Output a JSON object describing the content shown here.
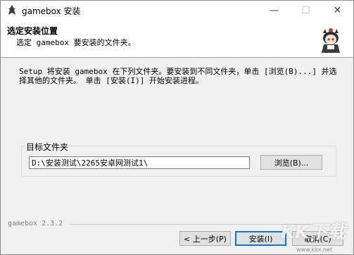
{
  "window": {
    "title": "gamebox 安装",
    "controls": {
      "minimize": "—",
      "maximize": "☐",
      "close": "✕"
    }
  },
  "header": {
    "title": "选定安装位置",
    "subtitle": "选定 gamebox 要安装的文件夹。"
  },
  "description": "Setup 将安装 gamebox 在下列文件夹。要安装到不同文件夹，单击 [浏览(B)...] 并选择其他的文件夹。 单击 [安装(I)] 开始安装进程。",
  "destination": {
    "group_label": "目标文件夹",
    "path_value": "D:\\安装测试\\2265安卓网测试1\\",
    "browse_label": "浏览(B)..."
  },
  "footer": {
    "version_text": "gamebox 2.3.2",
    "back_label": "< 上一步(P)",
    "install_label": "安装(I)",
    "cancel_label": "取消(C)"
  },
  "watermark": {
    "logo": "KK下载",
    "url": "www.kkx.net"
  }
}
